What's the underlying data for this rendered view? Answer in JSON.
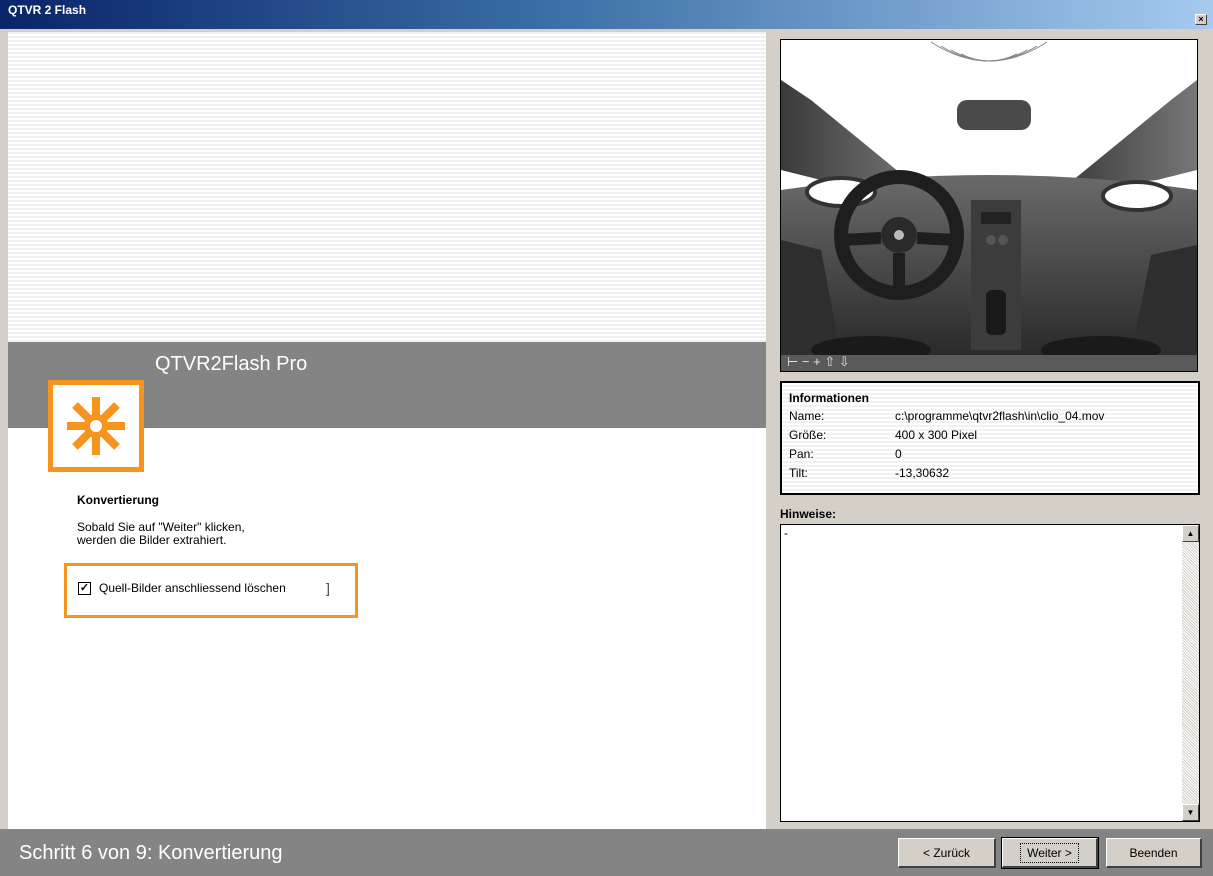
{
  "window": {
    "title": "QTVR 2 Flash",
    "close_glyph": "×"
  },
  "brand": {
    "title": "QTVR2Flash Pro",
    "logo_icon": "asterisk-logo-icon",
    "accent_color": "#f7941d"
  },
  "step": {
    "heading": "Konvertierung",
    "description_line1": "Sobald Sie auf \"Weiter\" klicken,",
    "description_line2": "werden die Bilder extrahiert.",
    "checkbox_label": "Quell-Bilder anschliessend löschen",
    "checkbox_checked": true,
    "checkbox_mark": "✓",
    "cursor_glyph": "]"
  },
  "preview": {
    "toolbar_glyphs": "⊢ − + ⇧ ⇩"
  },
  "info": {
    "title": "Informationen",
    "rows": [
      {
        "label": "Name:",
        "value": "c:\\programme\\qtvr2flash\\in\\clio_04.mov"
      },
      {
        "label": "Größe:",
        "value": "400 x 300 Pixel"
      },
      {
        "label": "Pan:",
        "value": "0"
      },
      {
        "label": "Tilt:",
        "value": "-13,30632"
      }
    ]
  },
  "hints": {
    "label": "Hinweise:",
    "text": "-",
    "scroll_up": "▲",
    "scroll_down": "▼"
  },
  "footer": {
    "status": "Schritt 6 von 9: Konvertierung",
    "back_label": "< Zurück",
    "next_label": "Weiter >",
    "finish_label": "Beenden"
  }
}
